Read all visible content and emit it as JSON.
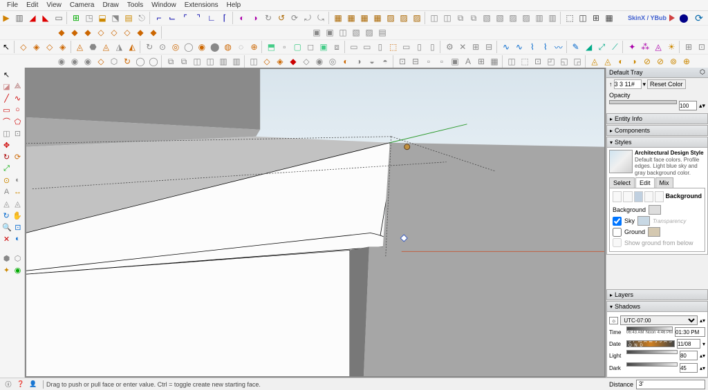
{
  "menu": [
    "File",
    "Edit",
    "View",
    "Camera",
    "Draw",
    "Tools",
    "Window",
    "Extensions",
    "Help"
  ],
  "skinx": {
    "label": "SkinX / YBub"
  },
  "status": {
    "hint": "Drag to push or pull face or enter value. Ctrl = toggle create new starting face.",
    "measure_label": "Distance",
    "measure_value": "3'"
  },
  "tray": {
    "title": "Default Tray",
    "reset_color": "Reset Color",
    "opacity_label": "Opacity",
    "opacity_value": "100",
    "panels": {
      "entity_info": "Entity Info",
      "components": "Components",
      "styles": "Styles",
      "layers": "Layers",
      "shadows": "Shadows"
    },
    "current_style": {
      "name": "Architectural Design Style",
      "desc": "Default face colors. Profile edges. Light blue sky and gray background color."
    },
    "style_tabs": [
      "Select",
      "Edit",
      "Mix"
    ],
    "active_tab": "Edit",
    "background_section": "Background",
    "bg_label": "Background",
    "sky_label": "Sky",
    "ground_label": "Ground",
    "transparency": "Transparency",
    "show_ground": "Show ground from below"
  },
  "shadows": {
    "tz": "UTC-07:00",
    "time_label": "Time",
    "time_start": "06:43 AM",
    "noon": "Noon",
    "time_end": "4:46 PM",
    "time_display": "01:30 PM",
    "date_label": "Date",
    "month_strip": "J F M A M J J A S O N D",
    "date_display": "11/08",
    "light_label": "Light",
    "light_value": "80",
    "dark_label": "Dark",
    "dark_value": "45"
  }
}
